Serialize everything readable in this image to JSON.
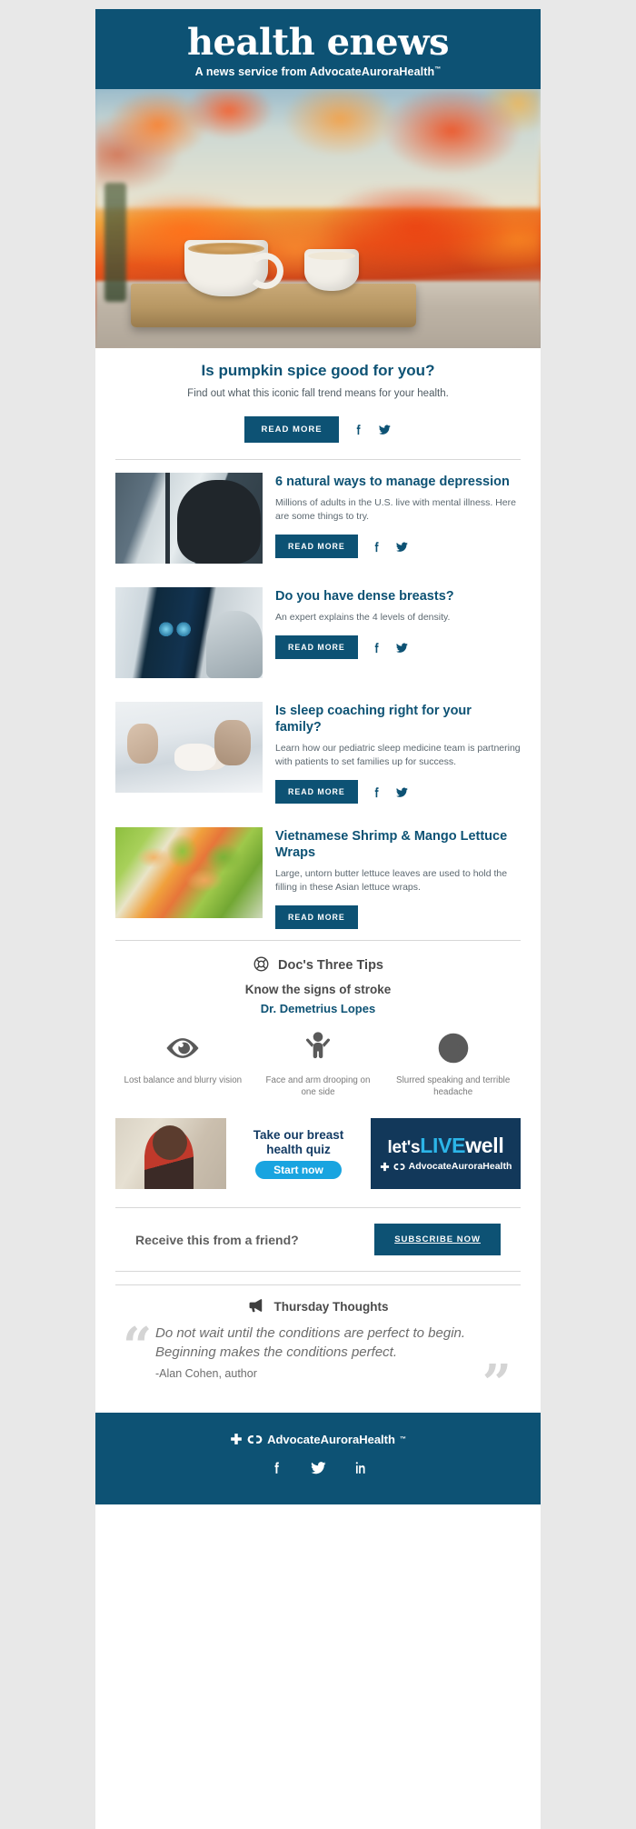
{
  "masthead": {
    "title": "health enews",
    "tagline_prefix": "A news service from ",
    "brand": "AdvocateAuroraHealth",
    "tm": "™",
    "bg_color": "#0d5274"
  },
  "hero": {
    "alt": "Two lattes on a wooden board with orange fall leaves"
  },
  "lead": {
    "title": "Is pumpkin spice good for you?",
    "description": "Find out what this iconic fall trend means for your health.",
    "read_more": "READ MORE",
    "facebook_icon": "facebook-icon",
    "twitter_icon": "twitter-icon"
  },
  "articles": [
    {
      "title": "6 natural ways to manage depression",
      "description": "Millions of adults in the U.S. live with mental illness. Here are some things to try.",
      "read_more": "READ MORE",
      "has_social": true,
      "thumb_class": "t-depression"
    },
    {
      "title": "Do you have dense breasts?",
      "description": "An expert explains the 4 levels of density.",
      "read_more": "READ MORE",
      "has_social": true,
      "thumb_class": "t-breast"
    },
    {
      "title": "Is sleep coaching right for your family?",
      "description": "Learn how our pediatric sleep medicine team is partnering with patients to set families up for success.",
      "read_more": "READ MORE",
      "has_social": true,
      "thumb_class": "t-sleep"
    },
    {
      "title": "Vietnamese Shrimp & Mango Lettuce Wraps",
      "description": "Large, untorn butter lettuce leaves are used to hold the filling in these Asian lettuce wraps.",
      "read_more": "READ MORE",
      "has_social": false,
      "thumb_class": "t-wraps"
    }
  ],
  "tips": {
    "heading": "Doc's Three Tips",
    "heading_icon": "lifebuoy-icon",
    "subheading": "Know the signs of stroke",
    "doctor": "Dr. Demetrius Lopes",
    "items": [
      {
        "icon": "eye-icon",
        "label": "Lost balance and blurry vision"
      },
      {
        "icon": "person-arms-raised-icon",
        "label": "Face and arm drooping on one side"
      },
      {
        "icon": "sad-face-icon",
        "label": "Slurred speaking and terrible headache"
      }
    ]
  },
  "ad": {
    "headline_line1": "Take our breast",
    "headline_line2": "health quiz",
    "button": "Start now",
    "lets": "let's",
    "live": "LIVE",
    "well": "well",
    "brand": "AdvocateAuroraHealth",
    "pill_color": "#19a4e0",
    "panel_color": "#12385a"
  },
  "subscribe": {
    "prompt": "Receive this from a friend?",
    "button": "SUBSCRIBE NOW"
  },
  "thoughts": {
    "heading": "Thursday Thoughts",
    "heading_icon": "megaphone-icon",
    "quote": "Do not wait until the conditions are perfect to begin. Beginning makes the conditions perfect.",
    "attribution": "-Alan Cohen, author",
    "open_quote": "“",
    "close_quote": "”"
  },
  "footer": {
    "brand": "AdvocateAuroraHealth",
    "tm": "™",
    "social": [
      "facebook-icon",
      "twitter-icon",
      "linkedin-icon"
    ],
    "bg_color": "#0d5274"
  }
}
